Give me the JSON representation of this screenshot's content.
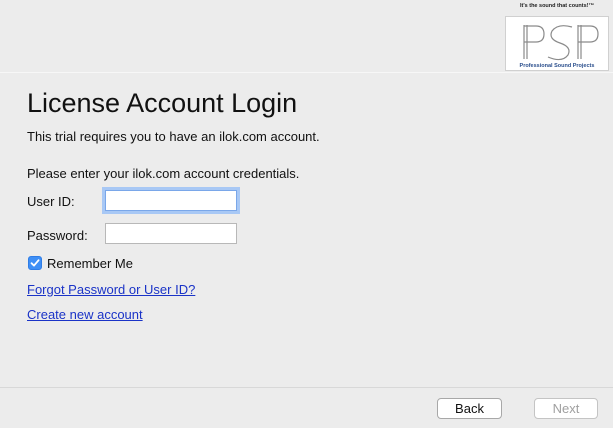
{
  "logo": {
    "tagline": "It's the sound that counts!™",
    "letters": "PSP",
    "caption": "Professional Sound Projects"
  },
  "page_title": "License Account Login",
  "intro_text": "This trial requires you to have an ilok.com account.",
  "credentials_prompt": "Please enter your ilok.com account credentials.",
  "form": {
    "user_id_label": "User ID:",
    "user_id_value": "",
    "password_label": "Password:",
    "password_value": "",
    "remember_label": "Remember Me",
    "remember_checked": true
  },
  "links": {
    "forgot": "Forgot Password or User ID?",
    "create": "Create new account"
  },
  "buttons": {
    "back": "Back",
    "next": "Next"
  },
  "colors": {
    "accent": "#3e8ff6",
    "link": "#1a33c7",
    "logo_caption": "#2a4e8c"
  }
}
